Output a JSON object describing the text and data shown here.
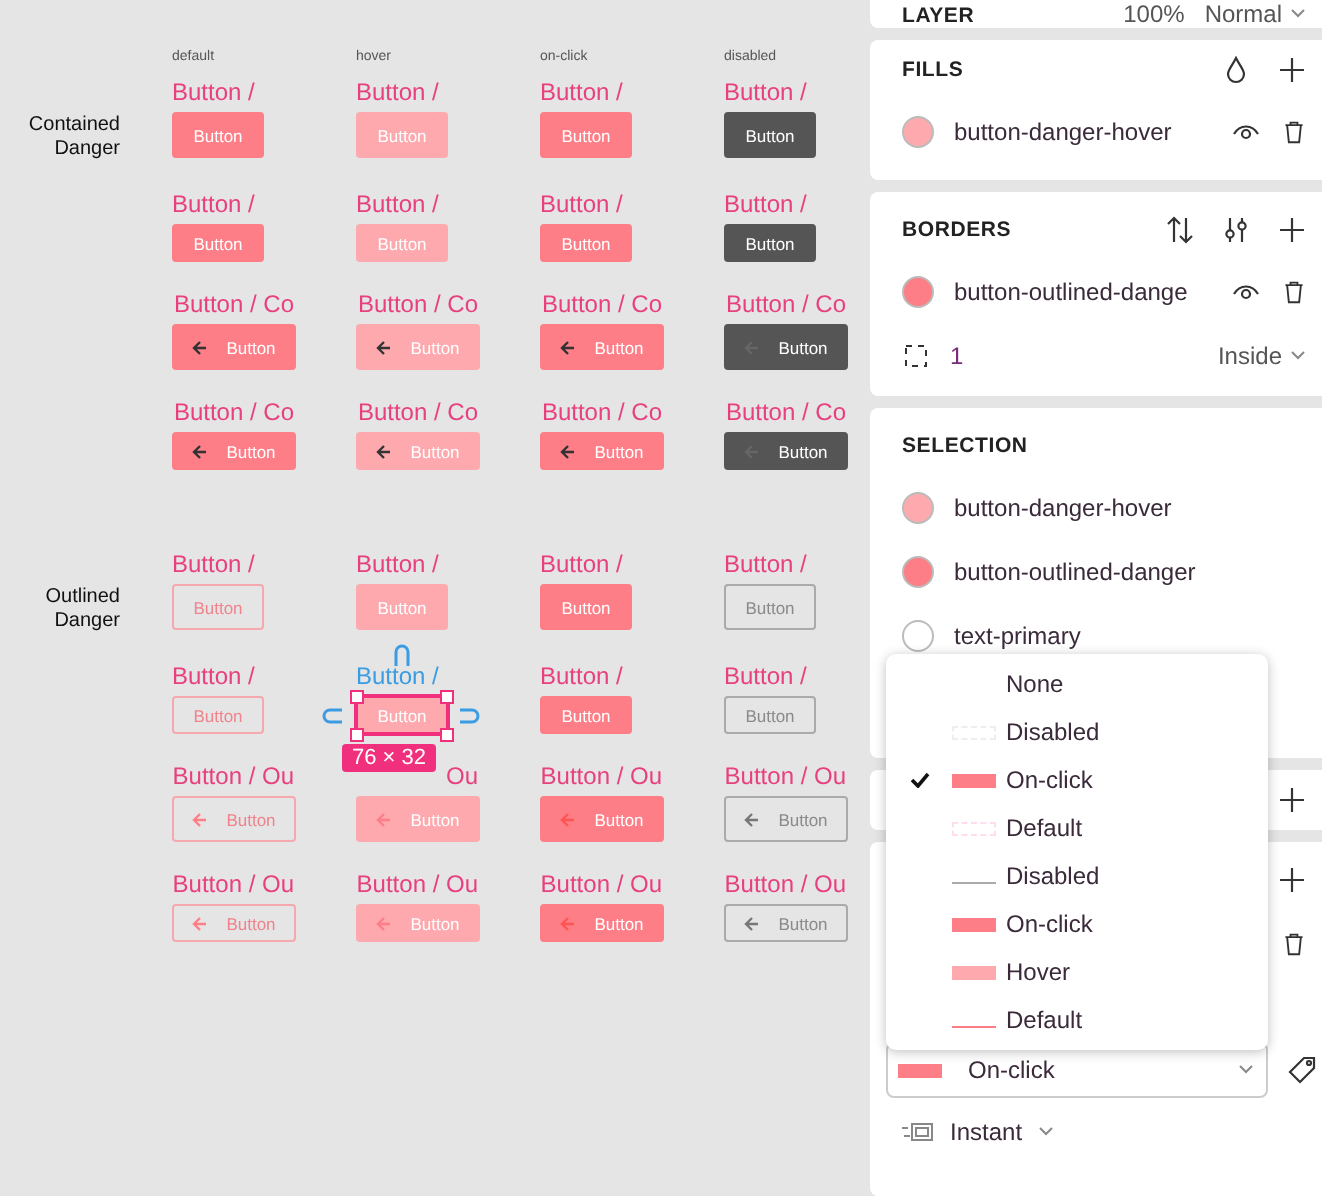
{
  "canvas": {
    "columns": [
      "default",
      "hover",
      "on-click",
      "disabled"
    ],
    "groups": [
      {
        "label": "Contained Danger",
        "rows": [
          {
            "cells": [
              {
                "label": "Button /",
                "button": "Button",
                "selected": false
              },
              {
                "label": "Button /",
                "button": "Button",
                "selected": false
              },
              {
                "label": "Button /",
                "button": "Button",
                "selected": false
              },
              {
                "label": "Button /",
                "button": "Button",
                "selected": false
              }
            ]
          },
          {
            "cells": [
              {
                "label": "Button /",
                "button": "Button",
                "selected": false
              },
              {
                "label": "Button /",
                "button": "Button",
                "selected": false
              },
              {
                "label": "Button /",
                "button": "Button",
                "selected": false
              },
              {
                "label": "Button /",
                "button": "Button",
                "selected": false
              }
            ]
          },
          {
            "cells": [
              {
                "label": "Button / Co",
                "button": "Button",
                "selected": false
              },
              {
                "label": "Button / Co",
                "button": "Button",
                "selected": false
              },
              {
                "label": "Button / Co",
                "button": "Button",
                "selected": false
              },
              {
                "label": "Button / Co",
                "button": "Button",
                "selected": false
              }
            ]
          },
          {
            "cells": [
              {
                "label": "Button / Co",
                "button": "Button",
                "selected": false
              },
              {
                "label": "Button / Co",
                "button": "Button",
                "selected": false
              },
              {
                "label": "Button / Co",
                "button": "Button",
                "selected": false
              },
              {
                "label": "Button / Co",
                "button": "Button",
                "selected": false
              }
            ]
          }
        ]
      },
      {
        "label": "Outlined Danger",
        "rows": [
          {
            "cells": [
              {
                "label": "Button /",
                "button": "Button",
                "selected": false
              },
              {
                "label": "Button /",
                "button": "Button",
                "selected": false
              },
              {
                "label": "Button /",
                "button": "Button",
                "selected": false
              },
              {
                "label": "Button /",
                "button": "Button",
                "selected": false
              }
            ]
          },
          {
            "cells": [
              {
                "label": "Button /",
                "button": "Button",
                "selected": false
              },
              {
                "label": "Button /",
                "button": "Button",
                "selected": true
              },
              {
                "label": "Button /",
                "button": "Button",
                "selected": false
              },
              {
                "label": "Button /",
                "button": "Button",
                "selected": false
              }
            ]
          },
          {
            "cells": [
              {
                "label": "Button / Ou",
                "button": "Button",
                "selected": false
              },
              {
                "label": "Ou",
                "button": "Button",
                "selected": false
              },
              {
                "label": "Button / Ou",
                "button": "Button",
                "selected": false
              },
              {
                "label": "Button / Ou",
                "button": "Button",
                "selected": false
              }
            ]
          },
          {
            "cells": [
              {
                "label": "Button / Ou",
                "button": "Button",
                "selected": false
              },
              {
                "label": "Button / Ou",
                "button": "Button",
                "selected": false
              },
              {
                "label": "Button / Ou",
                "button": "Button",
                "selected": false
              },
              {
                "label": "Button / Ou",
                "button": "Button",
                "selected": false
              }
            ]
          }
        ]
      }
    ],
    "size_badge": "76 × 32"
  },
  "panel": {
    "layer": {
      "title": "LAYER",
      "opacity": "100%",
      "blend": "Normal"
    },
    "fills": {
      "title": "FILLS",
      "items": [
        {
          "name": "button-danger-hover",
          "color": "#fea9ae"
        }
      ]
    },
    "borders": {
      "title": "BORDERS",
      "items": [
        {
          "name": "button-outlined-dange",
          "color": "#fd7e87"
        }
      ],
      "weight": "1",
      "position": "Inside"
    },
    "selection": {
      "title": "SELECTION",
      "items": [
        {
          "name": "button-danger-hover",
          "color": "#fea9ae"
        },
        {
          "name": "button-outlined-danger",
          "color": "#fd7e87"
        },
        {
          "name": "text-primary",
          "color": "#ffffff"
        }
      ]
    },
    "variant_select": {
      "value": "On-click"
    },
    "transition": "Instant"
  },
  "dropdown": [
    {
      "label": "None",
      "kind": "none",
      "selected": false
    },
    {
      "label": "Disabled",
      "kind": "faint",
      "selected": false
    },
    {
      "label": "On-click",
      "kind": "solid",
      "selected": true
    },
    {
      "label": "Default",
      "kind": "faint-pink",
      "selected": false
    },
    {
      "label": "Disabled",
      "kind": "outline-gray",
      "selected": false
    },
    {
      "label": "On-click",
      "kind": "solid",
      "selected": false
    },
    {
      "label": "Hover",
      "kind": "light",
      "selected": false
    },
    {
      "label": "Default",
      "kind": "outline-pink",
      "selected": false
    }
  ]
}
